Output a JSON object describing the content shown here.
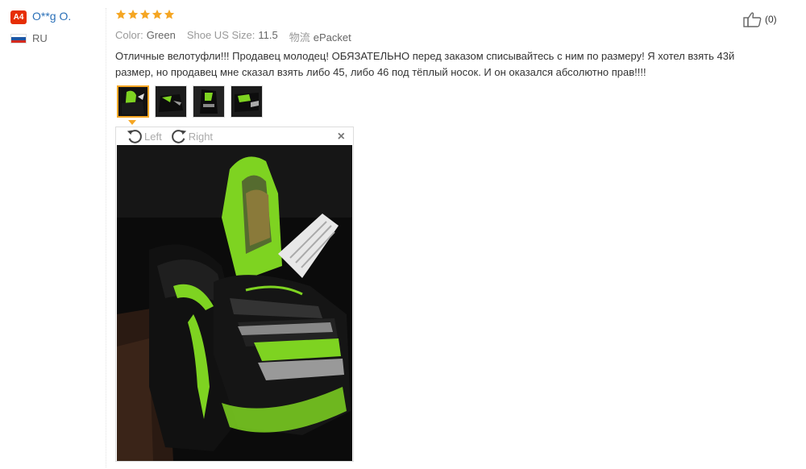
{
  "reviewer": {
    "badge": "A4",
    "name": "O**g O.",
    "country": "RU"
  },
  "rating": {
    "stars": 5,
    "max": 5
  },
  "attributes": [
    {
      "label": "Color:",
      "value": "Green"
    },
    {
      "label": "Shoe US Size:",
      "value": "11.5"
    },
    {
      "label": "物流",
      "value": "ePacket"
    }
  ],
  "helpful": {
    "count": "(0)"
  },
  "review": {
    "text": "Отличные велотуфли!!! Продавец молодец! ОБЯЗАТЕЛЬНО перед заказом списывайтесь с ним по размеру! Я хотел взять 43й размер, но продавец мне сказал взять либо 45, либо 46 под тёплый носок. И он оказался абсолютно прав!!!!"
  },
  "viewer": {
    "rotate_left": "Left",
    "rotate_right": "Right",
    "close": "×",
    "thumbnail_count": 4,
    "active_thumbnail": 1
  },
  "colors": {
    "accent_orange": "#f5a623",
    "link_blue": "#2a70b8",
    "badge_red": "#e62e04",
    "shoe_green": "#7ed321"
  },
  "icons": [
    "star-icon",
    "thumbs-up-icon",
    "rotate-left-icon",
    "rotate-right-icon",
    "close-icon",
    "russia-flag-icon"
  ]
}
